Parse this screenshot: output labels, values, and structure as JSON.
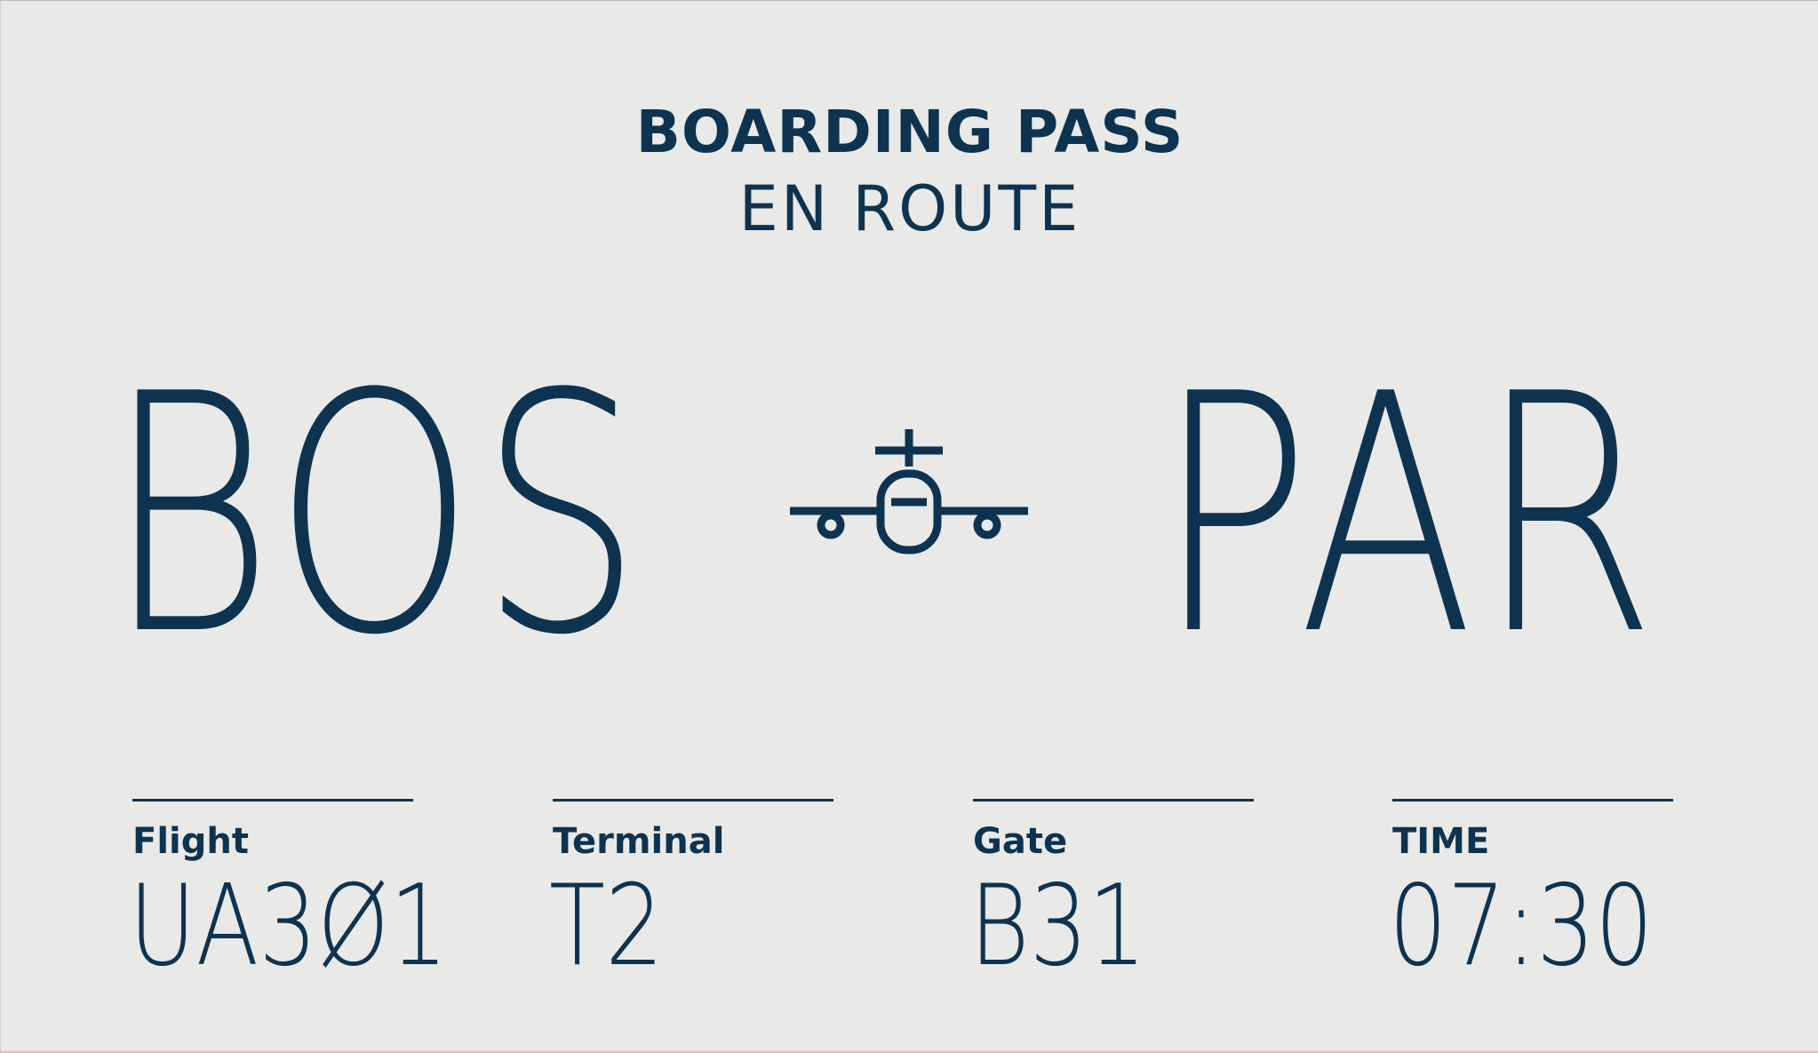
{
  "header": {
    "title": "BOARDING PASS",
    "status": "EN ROUTE"
  },
  "route": {
    "origin": "BOS",
    "destination": "PAR",
    "icon": "airplane-icon"
  },
  "details": [
    {
      "label": "Flight",
      "value": "UA3Ø1"
    },
    {
      "label": "Terminal",
      "value": "T2"
    },
    {
      "label": "Gate",
      "value": "B31"
    },
    {
      "label": "TIME",
      "value": "07:30"
    }
  ],
  "colors": {
    "background": "#e9e9e7",
    "ink": "#0d3350"
  }
}
